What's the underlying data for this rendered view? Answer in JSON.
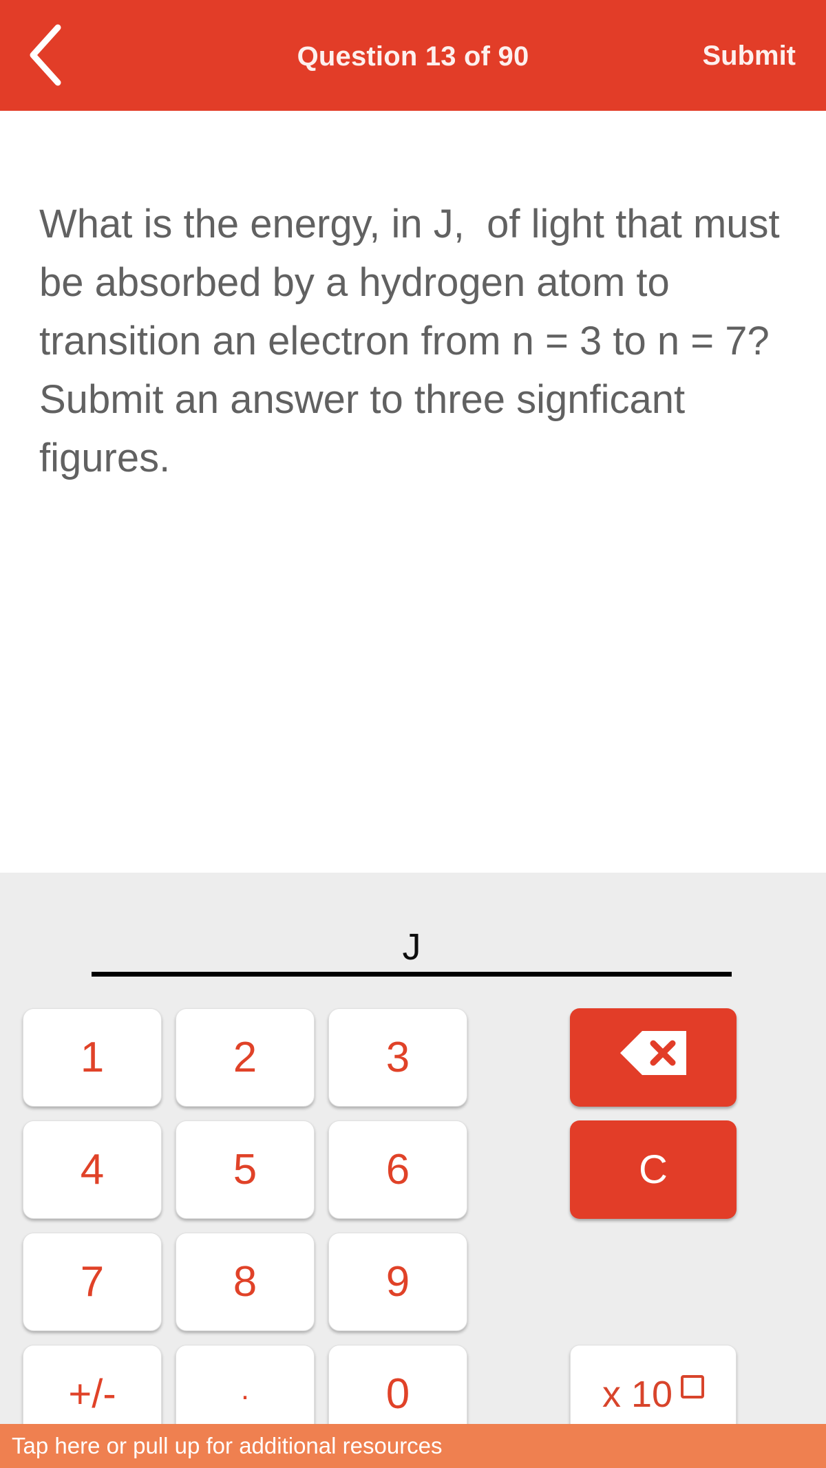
{
  "header": {
    "back_icon": "chevron-left-icon",
    "title": "Question 13 of 90",
    "submit_label": "Submit",
    "background_color": "#e23d28",
    "text_color": "#fdf0ee"
  },
  "question": {
    "text": "What is the energy, in J,  of light that must be absorbed by a hydrogen atom to transition an electron from n = 3 to n = 7? Submit an answer to three signficant figures.",
    "text_color": "#616161"
  },
  "answer": {
    "value": "",
    "unit": "J",
    "placeholder": ""
  },
  "keypad": {
    "background_color": "#ededed",
    "digit_color": "#e04228",
    "accent_color": "#e23d28",
    "keys": [
      {
        "label": "1",
        "name": "key-1"
      },
      {
        "label": "2",
        "name": "key-2"
      },
      {
        "label": "3",
        "name": "key-3"
      },
      {
        "label": "4",
        "name": "key-4"
      },
      {
        "label": "5",
        "name": "key-5"
      },
      {
        "label": "6",
        "name": "key-6"
      },
      {
        "label": "7",
        "name": "key-7"
      },
      {
        "label": "8",
        "name": "key-8"
      },
      {
        "label": "9",
        "name": "key-9"
      },
      {
        "label": "+/-",
        "name": "key-plus-minus"
      },
      {
        "label": ".",
        "name": "key-decimal"
      },
      {
        "label": "0",
        "name": "key-0"
      }
    ],
    "backspace_icon": "backspace-delete-icon",
    "clear_label": "C",
    "exponent_label": "x 10"
  },
  "bottom_bar": {
    "text": "Tap here or pull up for additional resources",
    "background_color": "#ef8050"
  }
}
